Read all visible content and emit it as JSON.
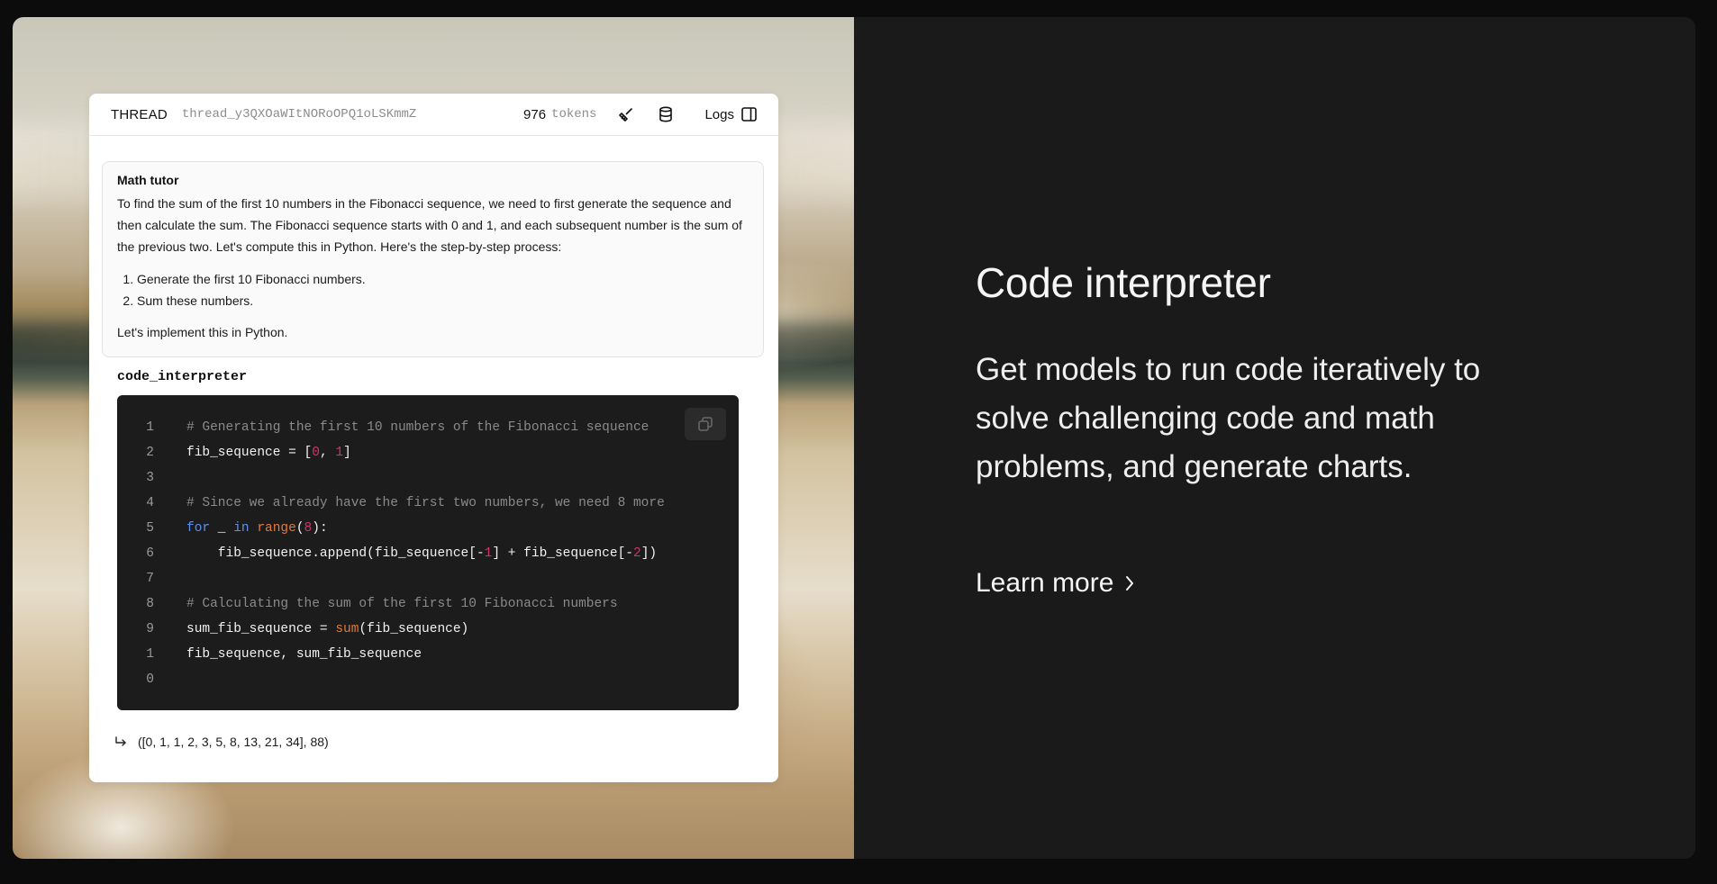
{
  "thread": {
    "label": "THREAD",
    "id": "thread_y3QXOaWItNORoOPQ1oLSKmmZ",
    "tokens": "976",
    "tokens_unit": "tokens",
    "logs_label": "Logs",
    "icons": [
      "broom-icon",
      "database-icon",
      "sidebar-panel-icon"
    ]
  },
  "message": {
    "title": "Math tutor",
    "body": "To find the sum of the first 10 numbers in the Fibonacci sequence, we need to first generate the sequence and then calculate the sum. The Fibonacci sequence starts with 0 and 1, and each subsequent number is the sum of the previous two. Let's compute this in Python. Here's the step-by-step process:",
    "steps": [
      "Generate the first 10 Fibonacci numbers.",
      "Sum these numbers."
    ],
    "outro": "Let's implement this in Python."
  },
  "tool": {
    "name": "code_interpreter",
    "copy_icon": "copy-icon",
    "line_numbers": [
      "1",
      "2",
      "3",
      "4",
      "5",
      "6",
      "7",
      "8",
      "9",
      "1",
      "0"
    ],
    "colors": {
      "comment": "#8a8a8a",
      "keyword": "#5b8ff0",
      "function": "#e0793a",
      "number": "#d0346c"
    },
    "code": {
      "l1": "# Generating the first 10 numbers of the Fibonacci sequence",
      "l2a": "fib_sequence = [",
      "l2b": "0",
      "l2c": ", ",
      "l2d": "1",
      "l2e": "]",
      "l4": "# Since we already have the first two numbers, we need 8 more",
      "l5a": "for",
      "l5b": " _ ",
      "l5c": "in",
      "l5d": " ",
      "l5e": "range",
      "l5f": "(",
      "l5g": "8",
      "l5h": "):",
      "l6a": "    fib_sequence.append(fib_sequence[-",
      "l6b": "1",
      "l6c": "] + fib_sequence[-",
      "l6d": "2",
      "l6e": "])",
      "l8": "# Calculating the sum of the first 10 Fibonacci numbers",
      "l9a": "sum_fib_sequence = ",
      "l9b": "sum",
      "l9c": "(fib_sequence)",
      "l10": "fib_sequence, sum_fib_sequence"
    },
    "result": "([0, 1, 1, 2, 3, 5, 8, 13, 21, 34], 88)"
  },
  "feature": {
    "title": "Code interpreter",
    "description": "Get models to run code iteratively to solve challenging code and math problems, and generate charts.",
    "learn_more": "Learn more"
  }
}
